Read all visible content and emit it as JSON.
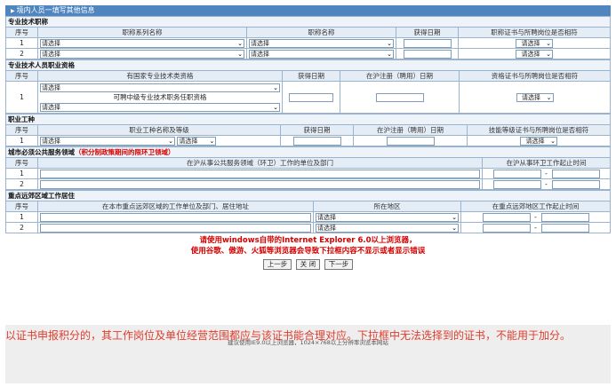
{
  "window_title": "境内人员一填写其他信息",
  "common": {
    "select": "请选择",
    "seq_header": "序号",
    "from_to_sep": "-"
  },
  "sec1": {
    "title": "专业技术职称",
    "headers": [
      "职称系列名称",
      "职称名称",
      "获得日期",
      "职称证书与所聘岗位是否相符"
    ],
    "rows": [
      {
        "no": "1"
      },
      {
        "no": "2"
      }
    ]
  },
  "sec2": {
    "title": "专业技术人员职业资格",
    "headers": [
      "有国家专业技术类资格",
      "获得日期",
      "在沪注册（聘用）日期",
      "资格证书与所聘岗位是否相符"
    ],
    "row": {
      "no": "1",
      "middle_text": "可聘中级专业技术职务任职资格"
    }
  },
  "sec3": {
    "title": "职业工种",
    "headers": [
      "职业工种名称及等级",
      "获得日期",
      "在沪注册（聘用）日期",
      "技能等级证书与所聘岗位是否相符"
    ],
    "row": {
      "no": "1"
    }
  },
  "sec4": {
    "title": "城市必须公共服务领域",
    "note": "（积分制政策期间的限环卫领域）",
    "headers": [
      "在沪从事公共服务领域（环卫）工作的单位及部门",
      "在沪从事环卫工作起止时间"
    ],
    "rows": [
      {
        "no": "1"
      },
      {
        "no": "2"
      }
    ]
  },
  "sec5": {
    "title": "重点远郊区域工作居住",
    "headers": [
      "在本市重点远郊区域的工作单位及部门、居住地址",
      "所在地区",
      "在重点远郊地区工作起止时间"
    ],
    "rows": [
      {
        "no": "1"
      },
      {
        "no": "2"
      }
    ]
  },
  "warning": {
    "line1": "请使用windows自带的Internet Explorer 6.0以上浏览器，",
    "line2": "使用谷歌、傲游、火狐等浏览器会导致下拉框内容不显示或者显示错误"
  },
  "buttons": {
    "prev": "上一步",
    "close": "关 闭",
    "next": "下一步"
  },
  "footnote": "以证书申报积分的，其工作岗位及单位经营范围都应与该证书能合理对应。下拉框中无法选择到的证书，不能用于加分。",
  "browser_hint": "建议使用IE9.0以上浏览器，1024×768以上分辨率浏览本网站"
}
